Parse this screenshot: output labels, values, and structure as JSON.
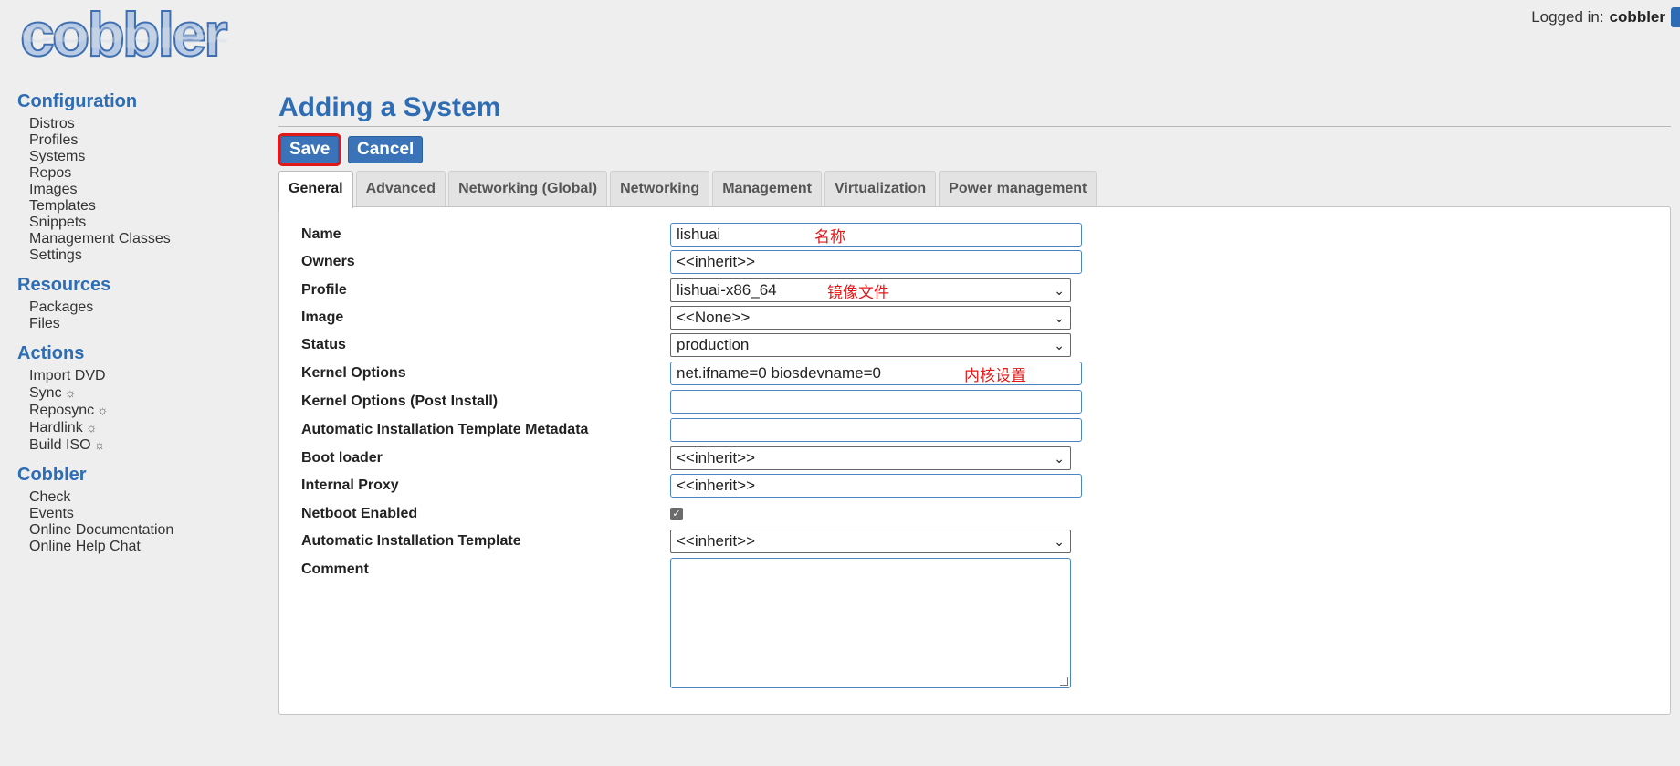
{
  "app": {
    "logo_text": "cobbler",
    "login_label": "Logged in:",
    "login_user": "cobbler"
  },
  "sidebar": {
    "sections": [
      {
        "title": "Configuration",
        "items": [
          "Distros",
          "Profiles",
          "Systems",
          "Repos",
          "Images",
          "Templates",
          "Snippets",
          "Management Classes",
          "Settings"
        ]
      },
      {
        "title": "Resources",
        "items": [
          "Packages",
          "Files"
        ]
      },
      {
        "title": "Actions",
        "items": [
          "Import DVD",
          "Sync",
          "Reposync",
          "Hardlink",
          "Build ISO"
        ]
      },
      {
        "title": "Cobbler",
        "items": [
          "Check",
          "Events",
          "Online Documentation",
          "Online Help Chat"
        ]
      }
    ],
    "spinner_glyph": "☼"
  },
  "page": {
    "title": "Adding a System",
    "save_label": "Save",
    "cancel_label": "Cancel"
  },
  "tabs": [
    "General",
    "Advanced",
    "Networking (Global)",
    "Networking",
    "Management",
    "Virtualization",
    "Power management"
  ],
  "form": {
    "name": {
      "label": "Name",
      "value": "lishuai",
      "note": "名称"
    },
    "owners": {
      "label": "Owners",
      "value": "<<inherit>>"
    },
    "profile": {
      "label": "Profile",
      "value": "lishuai-x86_64",
      "note": "镜像文件"
    },
    "image": {
      "label": "Image",
      "value": "<<None>>"
    },
    "status": {
      "label": "Status",
      "value": "production"
    },
    "kernel_options": {
      "label": "Kernel Options",
      "value": "net.ifname=0 biosdevname=0",
      "note": "内核设置"
    },
    "kernel_options_post": {
      "label": "Kernel Options (Post Install)",
      "value": ""
    },
    "autoinstall_meta": {
      "label": "Automatic Installation Template Metadata",
      "value": ""
    },
    "boot_loader": {
      "label": "Boot loader",
      "value": "<<inherit>>"
    },
    "internal_proxy": {
      "label": "Internal Proxy",
      "value": "<<inherit>>"
    },
    "netboot": {
      "label": "Netboot Enabled",
      "checked": true
    },
    "autoinstall": {
      "label": "Automatic Installation Template",
      "value": "<<inherit>>"
    },
    "comment": {
      "label": "Comment",
      "value": ""
    }
  },
  "colors": {
    "accent": "#2e6db4",
    "annotation": "#e01818"
  }
}
